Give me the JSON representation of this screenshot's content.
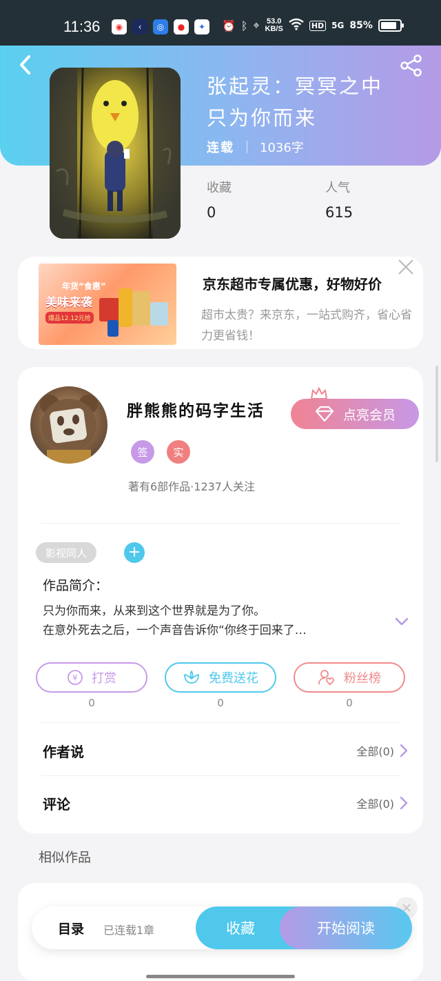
{
  "status_bar": {
    "time": "11:36",
    "speed_value": "53.0",
    "speed_unit": "KB/S",
    "network": "5G",
    "battery": "85%",
    "battery_level": 0.85,
    "hd": "HD"
  },
  "book": {
    "title_line1": "张起灵：冥冥之中",
    "title_line2": "只为你而来",
    "status": "连载",
    "word_count": "1036字"
  },
  "stats": {
    "favorites_label": "收藏",
    "favorites_value": "0",
    "popularity_label": "人气",
    "popularity_value": "615"
  },
  "ad": {
    "title": "京东超市专属优惠，好物好价",
    "description": "超市太贵？来京东，一站式购齐，省心省力更省钱！",
    "image_text_1": "年货“食惠”",
    "image_text_2": "美味来袭",
    "image_text_3": "爆品12.12元抢"
  },
  "author": {
    "name": "胖熊熊的码字生活",
    "vip_button": "点亮会员",
    "badge_1": "签",
    "badge_2": "实",
    "stats": "著有6部作品·1237人关注"
  },
  "work": {
    "tag": "影视同人",
    "tag_add": "+",
    "intro_title": "作品简介：",
    "intro_line1": "只为你而来，从来到这个世界就是为了你。",
    "intro_line2": "在意外死去之后，一个声音告诉你“你终于回来了…"
  },
  "actions": [
    {
      "label": "打赏",
      "count": "0",
      "color": "#c79ae8"
    },
    {
      "label": "免费送花",
      "count": "0",
      "color": "#4fc8ec"
    },
    {
      "label": "粉丝榜",
      "count": "0",
      "color": "#f08a8a"
    }
  ],
  "rows": {
    "author_says_label": "作者说",
    "author_says_right": "全部(0)",
    "comments_label": "评论",
    "comments_right": "全部(0)"
  },
  "similar": {
    "title": "相似作品"
  },
  "bottom_bar": {
    "toc_label": "目录",
    "toc_status": "已连载1章",
    "favorite_button": "收藏",
    "read_button": "开始阅读"
  },
  "colors": {
    "accent_cyan": "#4fc8ec",
    "accent_purple": "#b59ae6",
    "accent_pink": "#f08393"
  }
}
